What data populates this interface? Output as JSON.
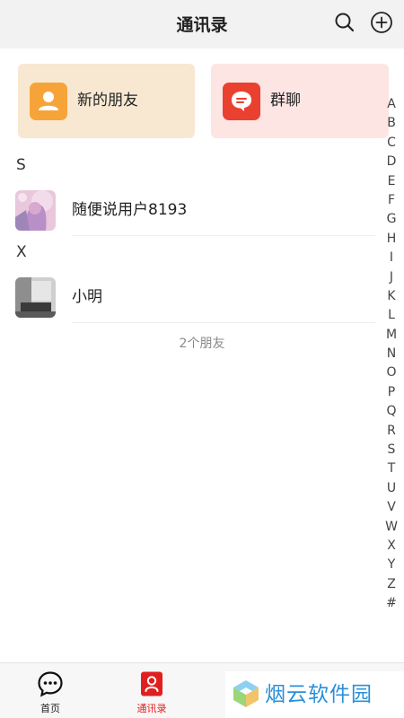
{
  "header": {
    "title": "通讯录",
    "icons": [
      "search-icon",
      "add-circle-icon"
    ]
  },
  "cards": {
    "new_friends": {
      "label": "新的朋友",
      "icon": "user-icon",
      "color": "#f6a43a",
      "background": "#f8e8d2"
    },
    "group_chat": {
      "label": "群聊",
      "icon": "chat-bubble-icon",
      "color": "#ea4030",
      "background": "#fde5e4"
    }
  },
  "sections": [
    {
      "letter": "S",
      "contacts": [
        {
          "name": "随便说用户8193",
          "avatar": "pink-illustration-avatar"
        }
      ]
    },
    {
      "letter": "X",
      "contacts": [
        {
          "name": "小明",
          "avatar": "room-photo-avatar"
        }
      ]
    }
  ],
  "friend_count": "2个朋友",
  "index_letters": [
    "A",
    "B",
    "C",
    "D",
    "E",
    "F",
    "G",
    "H",
    "I",
    "J",
    "K",
    "L",
    "M",
    "N",
    "O",
    "P",
    "Q",
    "R",
    "S",
    "T",
    "U",
    "V",
    "W",
    "X",
    "Y",
    "Z",
    "#"
  ],
  "tabbar": {
    "items": [
      {
        "label": "首页",
        "icon": "chat-dots-icon",
        "active": false
      },
      {
        "label": "通讯录",
        "icon": "contacts-icon",
        "active": true
      },
      {
        "label": "",
        "icon": "circle-icon",
        "active": false
      },
      {
        "label": "",
        "icon": "circle-icon",
        "active": false
      }
    ],
    "active_color": "#e02020"
  },
  "watermark": {
    "text": "烟云软件园",
    "color": "#2a8fd8"
  }
}
